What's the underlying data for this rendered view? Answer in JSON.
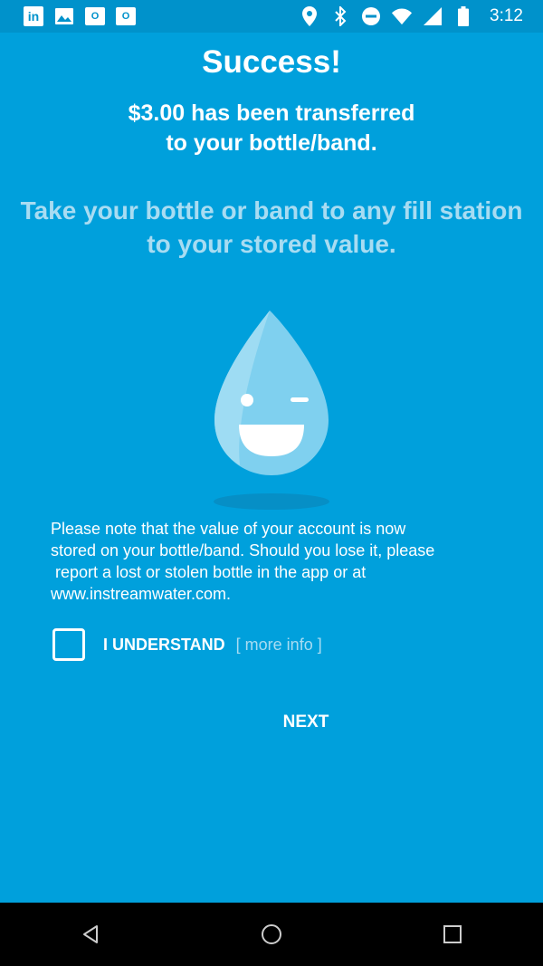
{
  "status_bar": {
    "time": "3:12",
    "left_icons": [
      "linkedin-icon",
      "image-icon",
      "outlook-icon",
      "outlook-icon"
    ],
    "right_icons": [
      "location-icon",
      "bluetooth-icon",
      "do-not-disturb-icon",
      "wifi-icon",
      "signal-icon",
      "battery-icon"
    ],
    "linkedin_text": "in",
    "outlook_text": "O"
  },
  "main": {
    "title": "Success!",
    "transfer_line1": "$3.00 has been transferred",
    "transfer_line2": "to your bottle/band.",
    "instruction_line1": "Take your bottle or band to any fill station",
    "instruction_line2": "to your stored value.",
    "mascot_icon": "water-drop-wink-icon",
    "note_line1": "Please note that the value of your account is now",
    "note_line2": "stored on your bottle/band. Should you lose it, please",
    "note_line3": " report a lost or stolen bottle in the app or at",
    "note_line4": "www.instreamwater.com.",
    "understand_label": "I UNDERSTAND",
    "more_info_label": "[ more info ]",
    "next_label": "NEXT"
  },
  "nav_bar": {
    "icons": [
      "back-icon",
      "home-icon",
      "recents-icon"
    ]
  },
  "colors": {
    "background": "#00a0dc",
    "status_bar": "#0092cb",
    "light_text": "#a8dcf2",
    "nav_bar": "#000000"
  }
}
